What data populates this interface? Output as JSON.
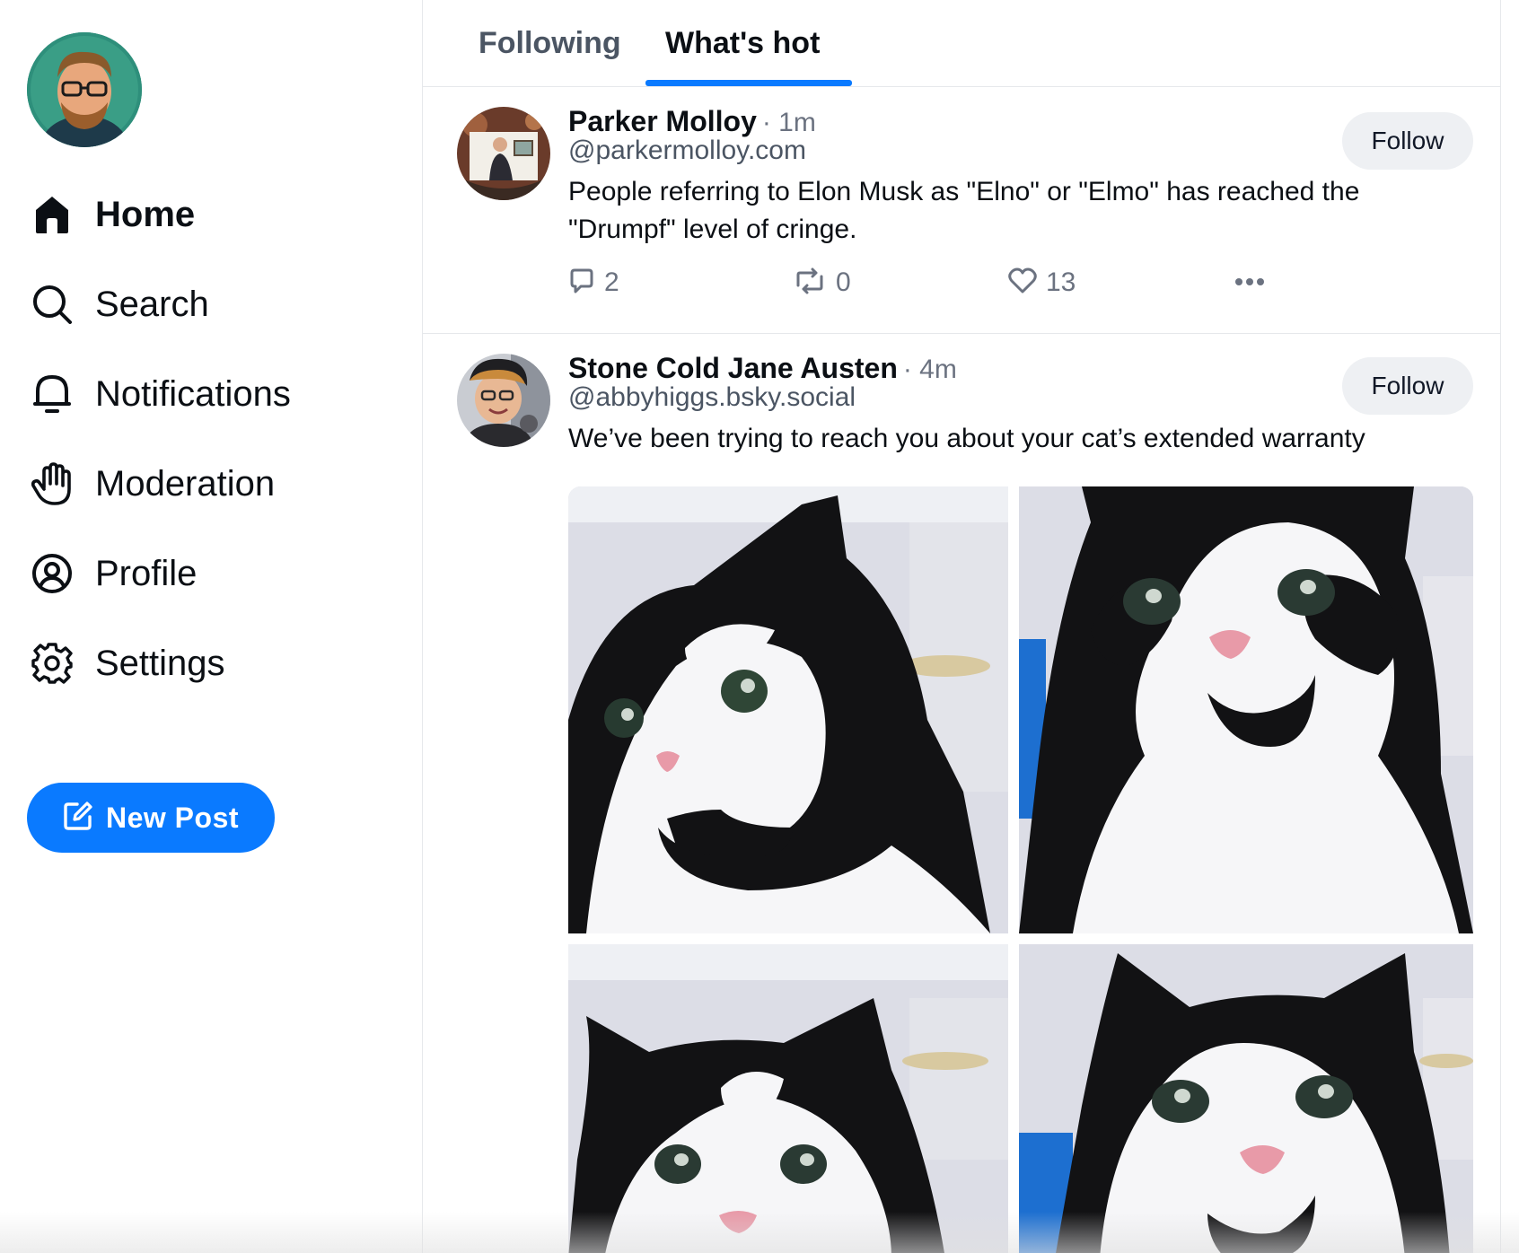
{
  "sidebar": {
    "avatar_icon": "user-avatar",
    "items": [
      {
        "label": "Home",
        "icon": "home-icon",
        "active": true
      },
      {
        "label": "Search",
        "icon": "search-icon",
        "active": false
      },
      {
        "label": "Notifications",
        "icon": "bell-icon",
        "active": false
      },
      {
        "label": "Moderation",
        "icon": "hand-icon",
        "active": false
      },
      {
        "label": "Profile",
        "icon": "user-circle-icon",
        "active": false
      },
      {
        "label": "Settings",
        "icon": "gear-icon",
        "active": false
      }
    ],
    "new_post_label": "New Post",
    "new_post_icon": "compose-icon"
  },
  "tabs": [
    {
      "label": "Following",
      "active": false
    },
    {
      "label": "What's hot",
      "active": true
    }
  ],
  "posts": [
    {
      "author": "Parker Molloy",
      "time": "· 1m",
      "handle": "@parkermolloy.com",
      "text": "People referring to Elon Musk as \"Elno\" or \"Elmo\" has reached  the \"Drumpf\" level of cringe.",
      "follow_label": "Follow",
      "replies": "2",
      "reposts": "0",
      "likes": "13"
    },
    {
      "author": "Stone Cold Jane Austen",
      "time": "· 4m",
      "handle": "@abbyhiggs.bsky.social",
      "text": "We’ve been trying to reach you about your cat’s extended warranty",
      "follow_label": "Follow",
      "media": [
        "cat photo",
        "cat photo",
        "cat photo",
        "cat photo"
      ]
    }
  ],
  "colors": {
    "accent": "#0a7aff",
    "text": "#0b0f14",
    "muted": "#6b7280",
    "border": "#e6e8eb",
    "follow_bg": "#eef0f3"
  }
}
